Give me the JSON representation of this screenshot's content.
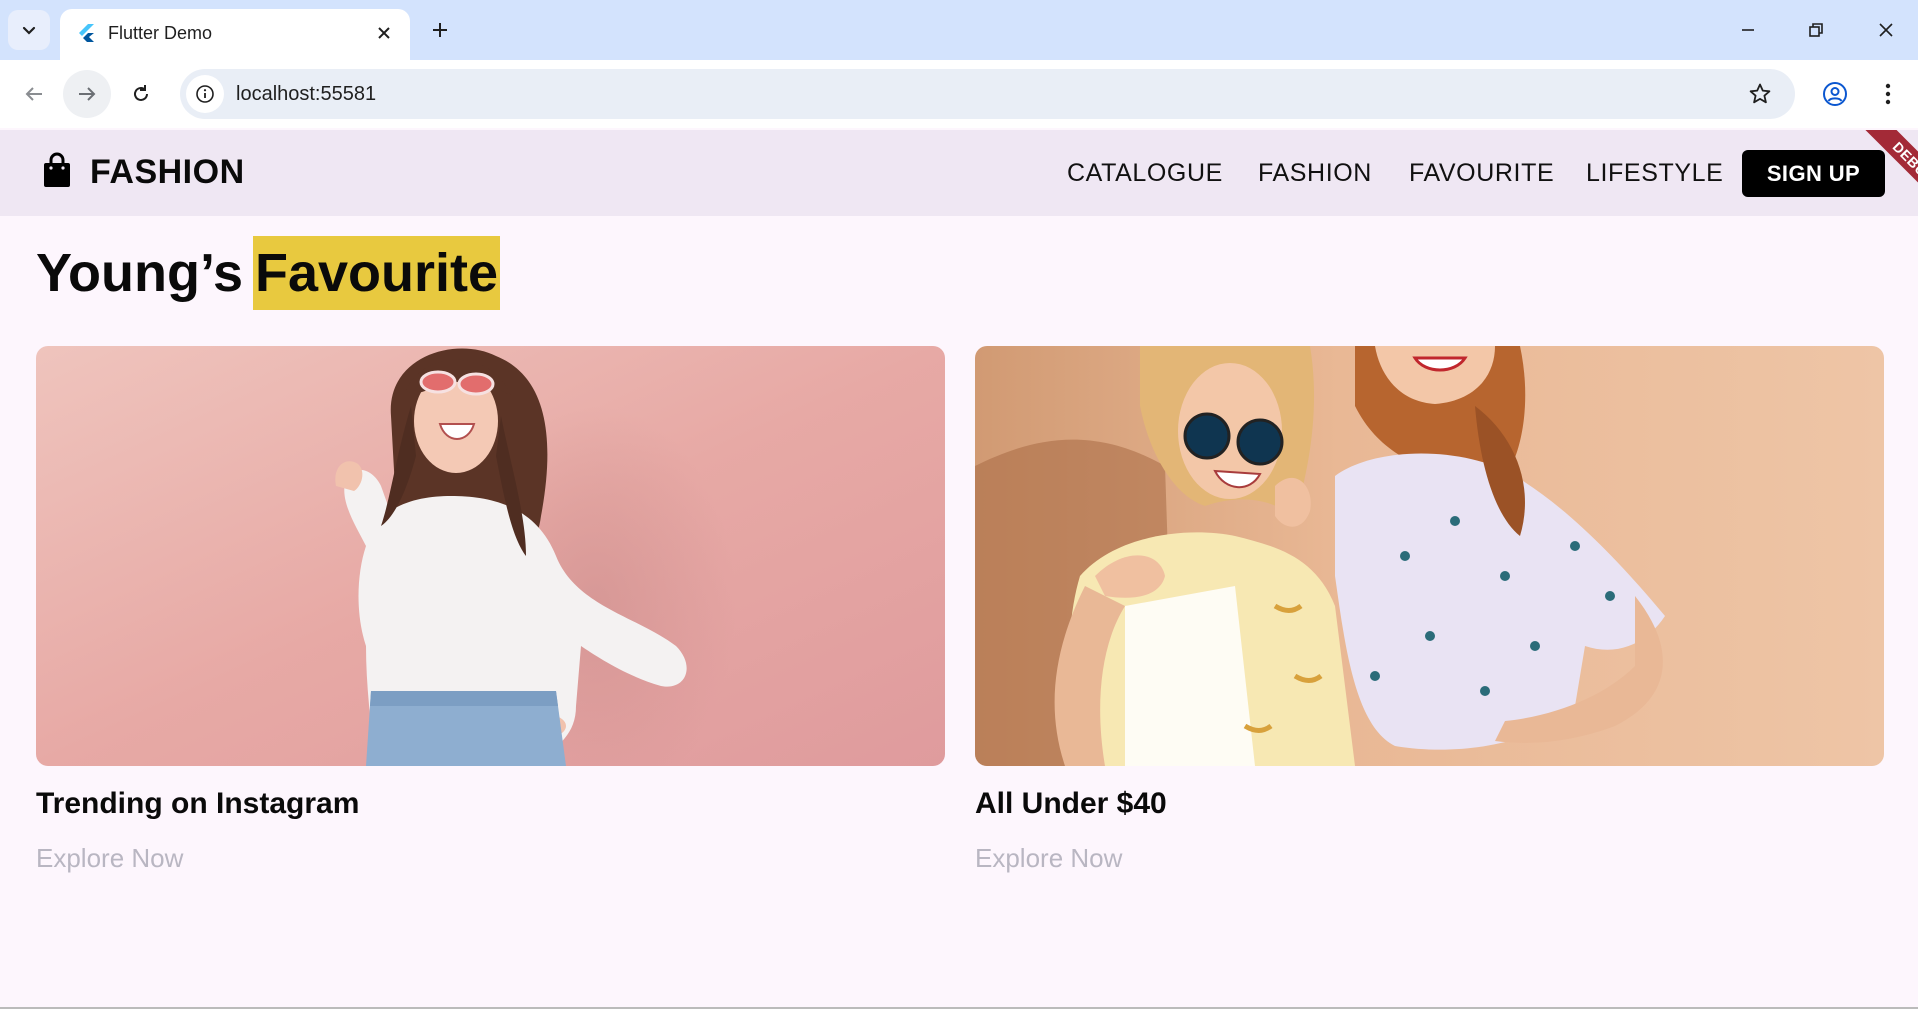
{
  "browser": {
    "tab_title": "Flutter Demo",
    "url": "localhost:55581"
  },
  "app": {
    "brand": "FASHION",
    "nav": [
      "CATALOGUE",
      "FASHION",
      "FAVOURITE",
      "LIFESTYLE"
    ],
    "signup_label": "SIGN UP",
    "debug_label": "DEBUG"
  },
  "headline": {
    "part1": "Young’s",
    "highlight": "Favourite"
  },
  "cards": [
    {
      "title": "Trending on Instagram",
      "link": "Explore Now"
    },
    {
      "title": "All Under $40",
      "link": "Explore Now"
    }
  ],
  "colors": {
    "highlight": "#e8c93f",
    "appbar_bg": "#efe7f3",
    "page_bg": "#fdf6fd",
    "link": "#b9b6c2"
  }
}
